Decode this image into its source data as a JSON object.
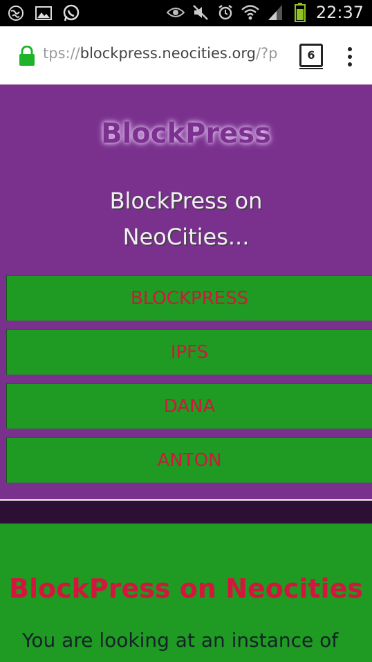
{
  "status_bar": {
    "left_icons": [
      "globe-icon",
      "image-icon",
      "whatsapp-icon"
    ],
    "right_icons": [
      "eye-icon",
      "mute-icon",
      "alarm-icon",
      "wifi-icon",
      "signal-icon",
      "battery-icon"
    ],
    "time": "22:37"
  },
  "browser": {
    "url_prefix": "tps://",
    "url_domain": "blockpress.neocities.org",
    "url_suffix": "/?p",
    "tab_count": "6",
    "lock_color": "#1fb32c"
  },
  "site": {
    "title": "BlockPress",
    "subtitle": "BlockPress on NeoCities...",
    "nav": [
      "BLOCKPRESS",
      "IPFS",
      "DANA",
      "ANTON"
    ],
    "heading": "BlockPress on Neocities",
    "intro": "You are looking at an instance of"
  },
  "colors": {
    "header_bg": "#7a318e",
    "button_bg": "#1f9a22",
    "button_text": "#d3163d"
  }
}
